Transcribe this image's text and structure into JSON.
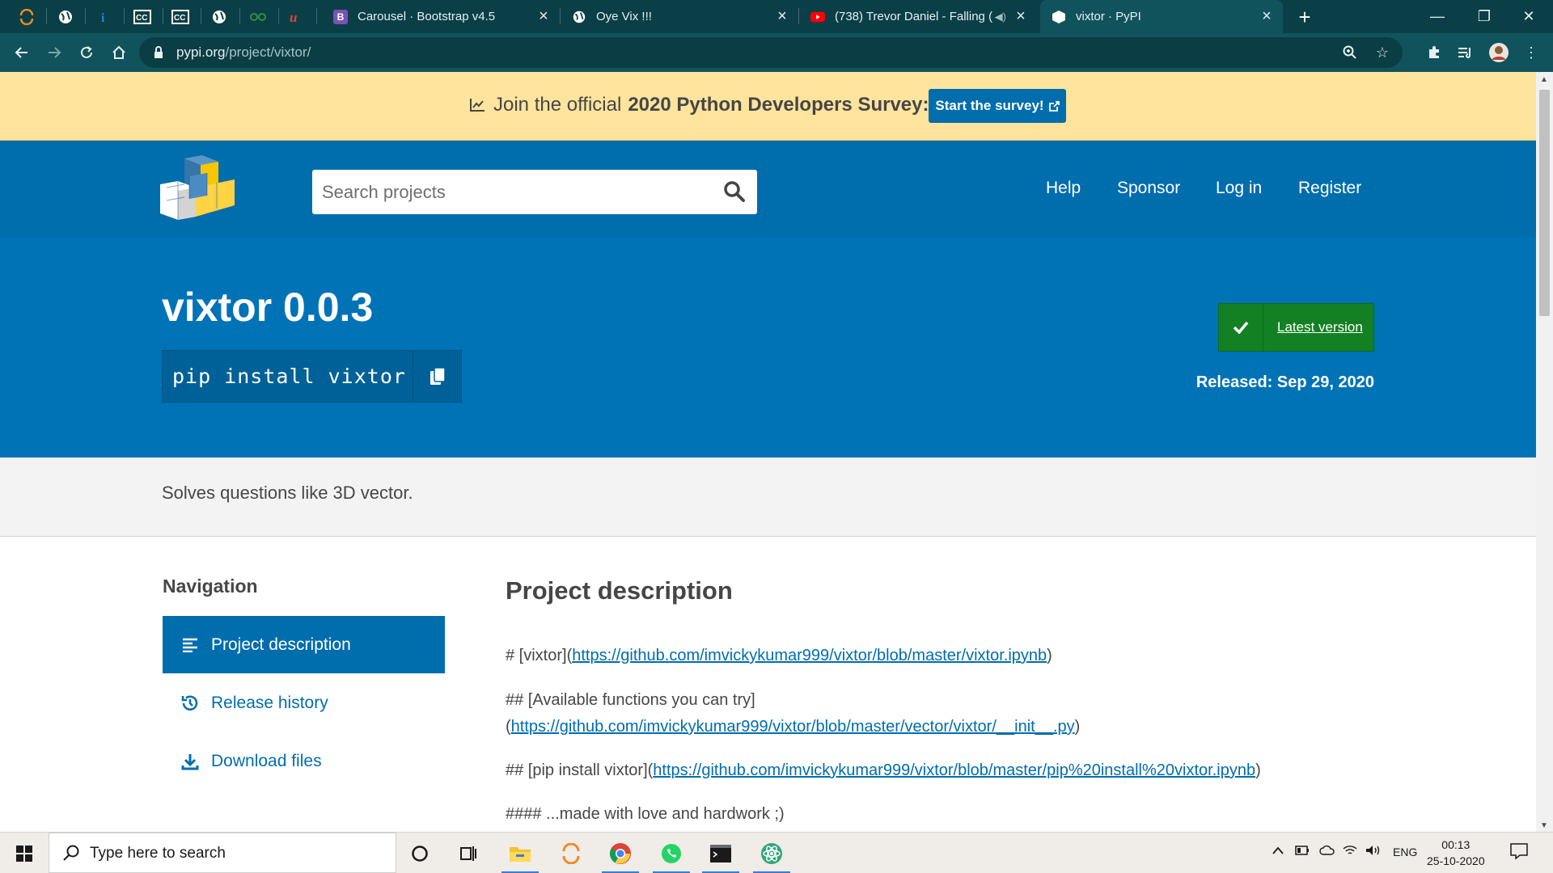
{
  "browser": {
    "tabs": [
      {
        "title": "Carousel · Bootstrap v4.5",
        "favicon": "B"
      },
      {
        "title": "Oye Vix !!!",
        "favicon": ""
      },
      {
        "title": "(738) Trevor Daniel - Falling (",
        "favicon": ""
      },
      {
        "title": "vixtor · PyPI",
        "favicon": ""
      }
    ],
    "url_host": "pypi.org",
    "url_path": "/project/vixtor/"
  },
  "notice": {
    "text": "Join the official",
    "bold": "2020 Python Developers Survey:",
    "button": "Start the survey!"
  },
  "header": {
    "search_placeholder": "Search projects",
    "nav": [
      "Help",
      "Sponsor",
      "Log in",
      "Register"
    ]
  },
  "package": {
    "title": "vixtor 0.0.3",
    "pip_command": "pip install vixtor",
    "latest_label": "Latest version",
    "released_label": "Released:",
    "released_date": "Sep 29, 2020"
  },
  "summary": "Solves questions like 3D vector.",
  "sidebar": {
    "title": "Navigation",
    "items": [
      {
        "label": "Project description",
        "active": true
      },
      {
        "label": "Release history",
        "active": false
      },
      {
        "label": "Download files",
        "active": false
      }
    ]
  },
  "description": {
    "title": "Project description",
    "line1_prefix": "# [vixtor](",
    "line1_link": "https://github.com/imvickykumar999/vixtor/blob/master/vixtor.ipynb",
    "line1_suffix": ")",
    "line2_prefix": "## [Available functions you can try]",
    "line2b_prefix": "(",
    "line2_link": "https://github.com/imvickykumar999/vixtor/blob/master/vector/vixtor/__init__.py",
    "line2_suffix": ")",
    "line3_prefix": "## [pip install vixtor](",
    "line3_link": "https://github.com/imvickykumar999/vixtor/blob/master/pip%20install%20vixtor.ipynb",
    "line3_suffix": ")",
    "line4": "#### ...made with love and hardwork ;)"
  },
  "taskbar": {
    "search_placeholder": "Type here to search",
    "lang": "ENG",
    "time": "00:13",
    "date": "25-10-2020"
  },
  "colors": {
    "pypi_blue": "#006dad",
    "banner_blue": "#0073b7",
    "notice_yellow": "#fee49d",
    "success_green": "#148024"
  }
}
